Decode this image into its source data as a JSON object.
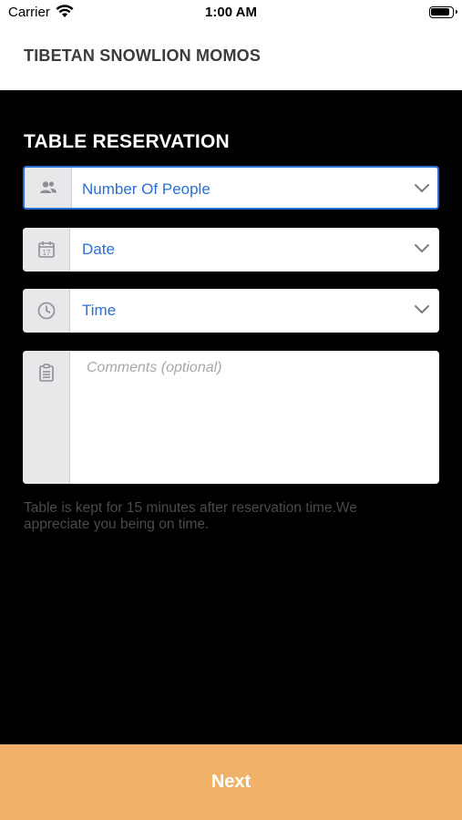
{
  "status_bar": {
    "carrier": "Carrier",
    "time": "1:00 AM"
  },
  "header": {
    "title": "TIBETAN SNOWLION MOMOS"
  },
  "form": {
    "section_title": "TABLE RESERVATION",
    "people": {
      "value": "Number Of People",
      "icon": "people-icon"
    },
    "date": {
      "value": "Date",
      "icon": "calendar-icon"
    },
    "time": {
      "value": "Time",
      "icon": "clock-icon"
    },
    "comments": {
      "placeholder": "Comments (optional)",
      "icon": "notepad-icon"
    },
    "note": "Table is kept for 15 minutes after reservation time.We appreciate you being on time."
  },
  "footer": {
    "next_label": "Next"
  },
  "colors": {
    "accent": "#2a6fd6",
    "button": "#f2b168",
    "background": "#000000"
  }
}
